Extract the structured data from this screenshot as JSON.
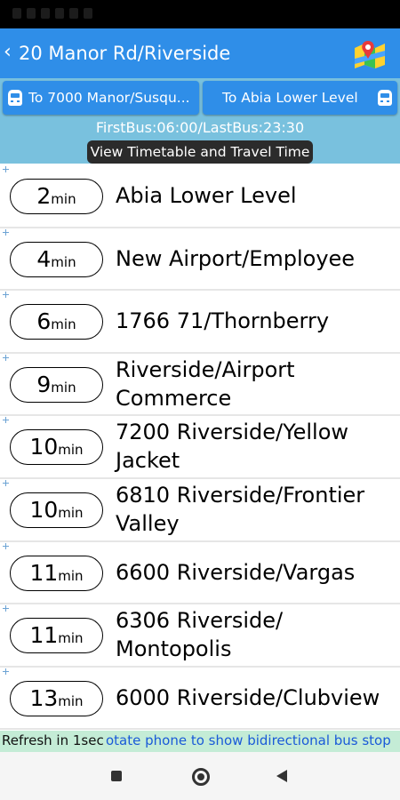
{
  "header": {
    "back_glyph": "‹",
    "title": "20 Manor Rd/Riverside"
  },
  "directions": [
    {
      "label": "To 7000 Manor/Susqu..."
    },
    {
      "label": "To Abia Lower Level"
    }
  ],
  "bus_range": "FirstBus:06:00/LastBus:23:30",
  "timetable_button": "View Timetable and Travel Time",
  "stops": [
    {
      "eta": "2",
      "unit": "min",
      "name": "Abia Lower Level"
    },
    {
      "eta": "4",
      "unit": "min",
      "name": "New Airport/Employee"
    },
    {
      "eta": "6",
      "unit": "min",
      "name": "1766 71/Thornberry"
    },
    {
      "eta": "9",
      "unit": "min",
      "name": "Riverside/Airport Commerce"
    },
    {
      "eta": "10",
      "unit": "min",
      "name": "7200 Riverside/Yellow Jacket"
    },
    {
      "eta": "10",
      "unit": "min",
      "name": "6810 Riverside/Frontier Valley"
    },
    {
      "eta": "11",
      "unit": "min",
      "name": "6600 Riverside/Vargas"
    },
    {
      "eta": "11",
      "unit": "min",
      "name": "6306 Riverside/ Montopolis"
    },
    {
      "eta": "13",
      "unit": "min",
      "name": "6000 Riverside/Clubview"
    }
  ],
  "footer": {
    "refresh": "Refresh in 1sec",
    "marquee": "otate phone to show bidirectional bus stop"
  },
  "colors": {
    "appbar": "#2f8ee8",
    "direction_bar": "#79c1de",
    "refresh_bar": "#c4ecd6"
  }
}
